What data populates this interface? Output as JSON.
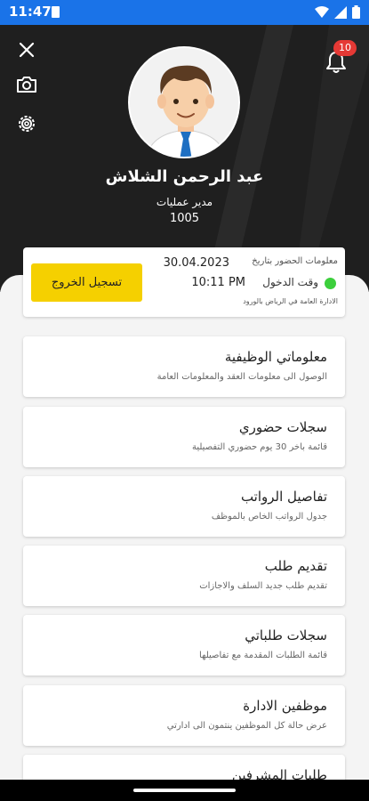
{
  "status_bar": {
    "time": "11:47"
  },
  "header": {
    "notification_count": "10",
    "user_name": "عبد الرحمن الشلاش",
    "user_role": "مدير عمليات",
    "user_id": "1005"
  },
  "attendance": {
    "label": "معلومات الحضور بتاريخ",
    "date": "30.04.2023",
    "login_label": "وقت الدخول",
    "login_time": "10:11 PM",
    "location": "الادارة العامة في الرياض بالورود",
    "checkout_label": "تسجيل الخروج"
  },
  "menu": [
    {
      "title": "معلوماتي الوظيفية",
      "subtitle": "الوصول الى معلومات العقد والمعلومات العامة"
    },
    {
      "title": "سجلات حضوري",
      "subtitle": "قائمة باخر 30 يوم حضوري التفصيلية"
    },
    {
      "title": "تفاصيل الرواتب",
      "subtitle": "جدول الرواتب الخاص بالموظف"
    },
    {
      "title": "تقديم طلب",
      "subtitle": "تقديم طلب جديد السلف والاجازات"
    },
    {
      "title": "سجلات طلباتي",
      "subtitle": "قائمة الطلبات المقدمة مع تفاصيلها"
    },
    {
      "title": "موظفين الادارة",
      "subtitle": "عرض حالة كل الموظفين ينتمون الى ادارتي"
    },
    {
      "title": "طلبات المشرفين",
      "subtitle": ""
    }
  ],
  "colors": {
    "status_bar": "#1a73e8",
    "header_bg": "#1f1f1f",
    "accent": "#f5d000",
    "online": "#3ccf3c",
    "badge": "#e53935"
  },
  "icons": [
    "close-icon",
    "camera-icon",
    "settings-icon",
    "bell-icon",
    "wifi-icon",
    "signal-icon",
    "battery-icon",
    "sim-icon"
  ]
}
